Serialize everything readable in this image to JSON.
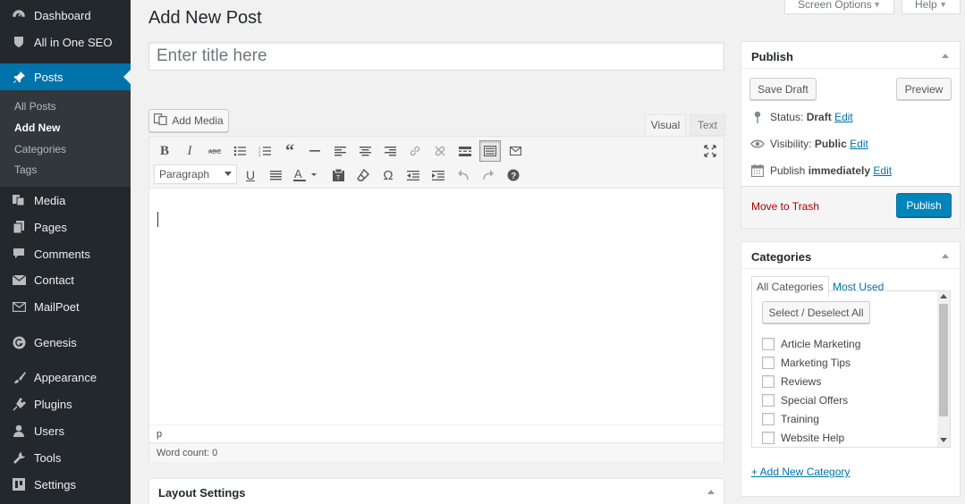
{
  "sidebar": {
    "items": [
      {
        "label": "Dashboard",
        "icon": "dashboard-icon"
      },
      {
        "label": "All in One SEO",
        "icon": "shield-icon"
      },
      {
        "label": "Posts",
        "icon": "pin-icon"
      },
      {
        "label": "Media",
        "icon": "media-icon"
      },
      {
        "label": "Pages",
        "icon": "pages-icon"
      },
      {
        "label": "Comments",
        "icon": "comment-icon"
      },
      {
        "label": "Contact",
        "icon": "envelope-icon"
      },
      {
        "label": "MailPoet",
        "icon": "mail-icon"
      },
      {
        "label": "Genesis",
        "icon": "genesis-icon"
      },
      {
        "label": "Appearance",
        "icon": "brush-icon"
      },
      {
        "label": "Plugins",
        "icon": "plug-icon"
      },
      {
        "label": "Users",
        "icon": "user-icon"
      },
      {
        "label": "Tools",
        "icon": "wrench-icon"
      },
      {
        "label": "Settings",
        "icon": "settings-icon"
      }
    ],
    "submenu": [
      "All Posts",
      "Add New",
      "Categories",
      "Tags"
    ]
  },
  "header": {
    "title": "Add New Post",
    "screen_options": "Screen Options",
    "help": "Help"
  },
  "editor": {
    "title_placeholder": "Enter title here",
    "add_media": "Add Media",
    "tab_visual": "Visual",
    "tab_text": "Text",
    "format": "Paragraph",
    "path": "p",
    "word_count": "Word count: 0"
  },
  "layout_settings": {
    "title": "Layout Settings"
  },
  "publish": {
    "title": "Publish",
    "save_draft": "Save Draft",
    "preview": "Preview",
    "status_label": "Status:",
    "status_value": "Draft",
    "visibility_label": "Visibility:",
    "visibility_value": "Public",
    "publish_label": "Publish",
    "publish_value": "immediately",
    "edit": "Edit",
    "trash": "Move to Trash",
    "publish_button": "Publish"
  },
  "categories": {
    "title": "Categories",
    "tab_all": "All Categories",
    "tab_used": "Most Used",
    "select_all": "Select / Deselect All",
    "items": [
      "Article Marketing",
      "Marketing Tips",
      "Reviews",
      "Special Offers",
      "Training",
      "Website Help"
    ],
    "add_new": "+ Add New Category"
  },
  "colors": {
    "sidebar_bg": "#23282d",
    "accent": "#0073aa",
    "publish_btn": "#0085ba"
  }
}
